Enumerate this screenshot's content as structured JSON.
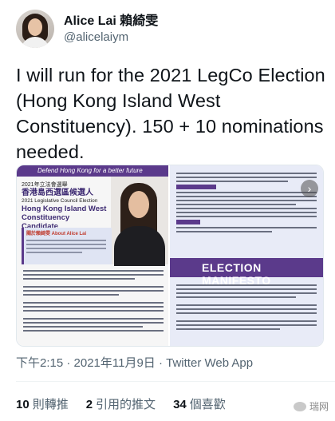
{
  "user": {
    "display_name": "Alice Lai 賴綺雯",
    "handle": "@alicelaiym"
  },
  "tweet": {
    "text": "I will run for the 2021 LegCo Election (Hong Kong Island West Constituency). 150 + 10 nominations needed."
  },
  "media": {
    "banner_text": "Defend Hong Kong for a better future",
    "cn_small": "2021年立法會選舉",
    "cn_big": "香港島西選區候選人",
    "en_small": "2021 Legislative Council Election",
    "en_big_1": "Hong Kong Island West",
    "en_big_2": "Constituency Candidate",
    "about_label": "關於賴綺雯 About Alice Lai",
    "manifesto_title": "ELECTION MANIFESTO",
    "accent_color": "#5b3a8b"
  },
  "meta": {
    "timestamp": "下午2:15 · 2021年11月9日 · Twitter Web App"
  },
  "stats": {
    "retweets_count": "10",
    "retweets_label": "則轉推",
    "quotes_count": "2",
    "quotes_label": "引用的推文",
    "likes_count": "34",
    "likes_label": "個喜歡"
  },
  "watermark": {
    "text": "瑞网"
  }
}
